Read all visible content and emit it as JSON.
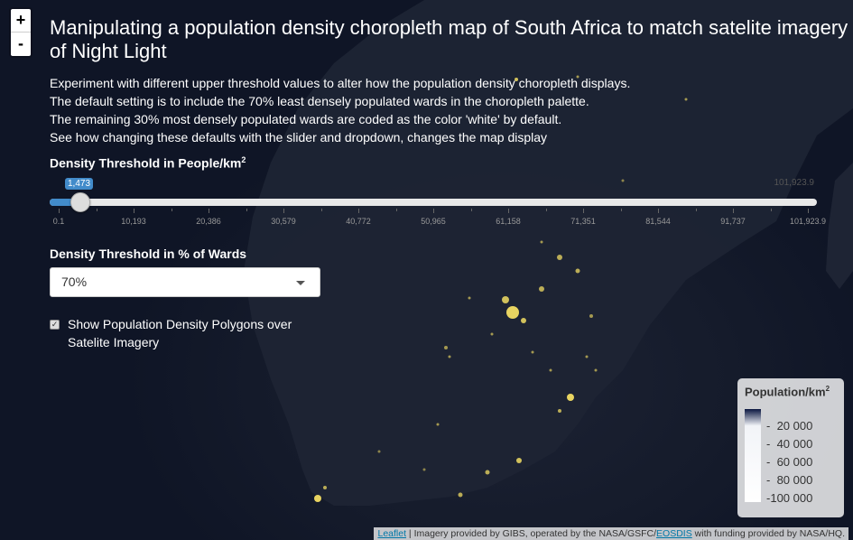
{
  "map": {
    "zoom_in": "+",
    "zoom_out": "-"
  },
  "title": "Manipulating a population density choropleth map of South Africa to match satelite imagery of Night Light",
  "description": [
    "Experiment with different upper threshold values to alter how the population density choropleth displays.",
    "The default setting is to include the 70% least densely populated wards in the choropleth palette.",
    "The remaining 30% most densely populated wards are coded as the color 'white' by default.",
    "See how changing these defaults with the slider and dropdown, changes the map display"
  ],
  "density_slider": {
    "label": "Density Threshold in People/km",
    "label_sup": "2",
    "value_label": "1,473",
    "value": 1473,
    "min": 0.1,
    "max": 101923.9,
    "max_label": "101,923.9",
    "tick_labels": [
      "0.1",
      "10,193",
      "20,386",
      "30,579",
      "40,772",
      "50,965",
      "61,158",
      "71,351",
      "81,544",
      "91,737",
      "101,923.9"
    ]
  },
  "percent_select": {
    "label": "Density Threshold in % of Wards",
    "value": "70%"
  },
  "overlay_checkbox": {
    "checked": true,
    "label": "Show Population Density Polygons over Satelite Imagery"
  },
  "legend": {
    "title": "Population/km",
    "title_sup": "2",
    "labels": [
      "20 000",
      "40 000",
      "60 000",
      "80 000",
      "100 000"
    ],
    "color_low": "#0a1640",
    "color_high": "#ffffff"
  },
  "attribution": {
    "leaflet_link": "Leaflet",
    "text_1": " | Imagery provided by GIBS, operated by the NASA/GSFC/",
    "eosdis_link": "EOSDIS",
    "text_2": " with funding provided by NASA/HQ."
  }
}
